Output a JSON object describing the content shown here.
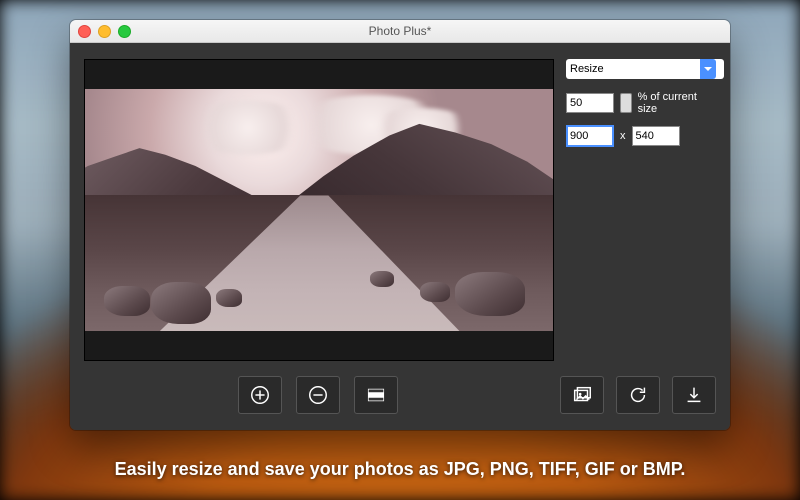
{
  "window": {
    "title": "Photo Plus*"
  },
  "panel": {
    "select_value": "Resize",
    "percent_value": "50",
    "percent_label": "% of current size",
    "width_value": "900",
    "x_label": "x",
    "height_value": "540"
  },
  "caption": "Easily resize and save your photos as JPG, PNG, TIFF, GIF or BMP."
}
